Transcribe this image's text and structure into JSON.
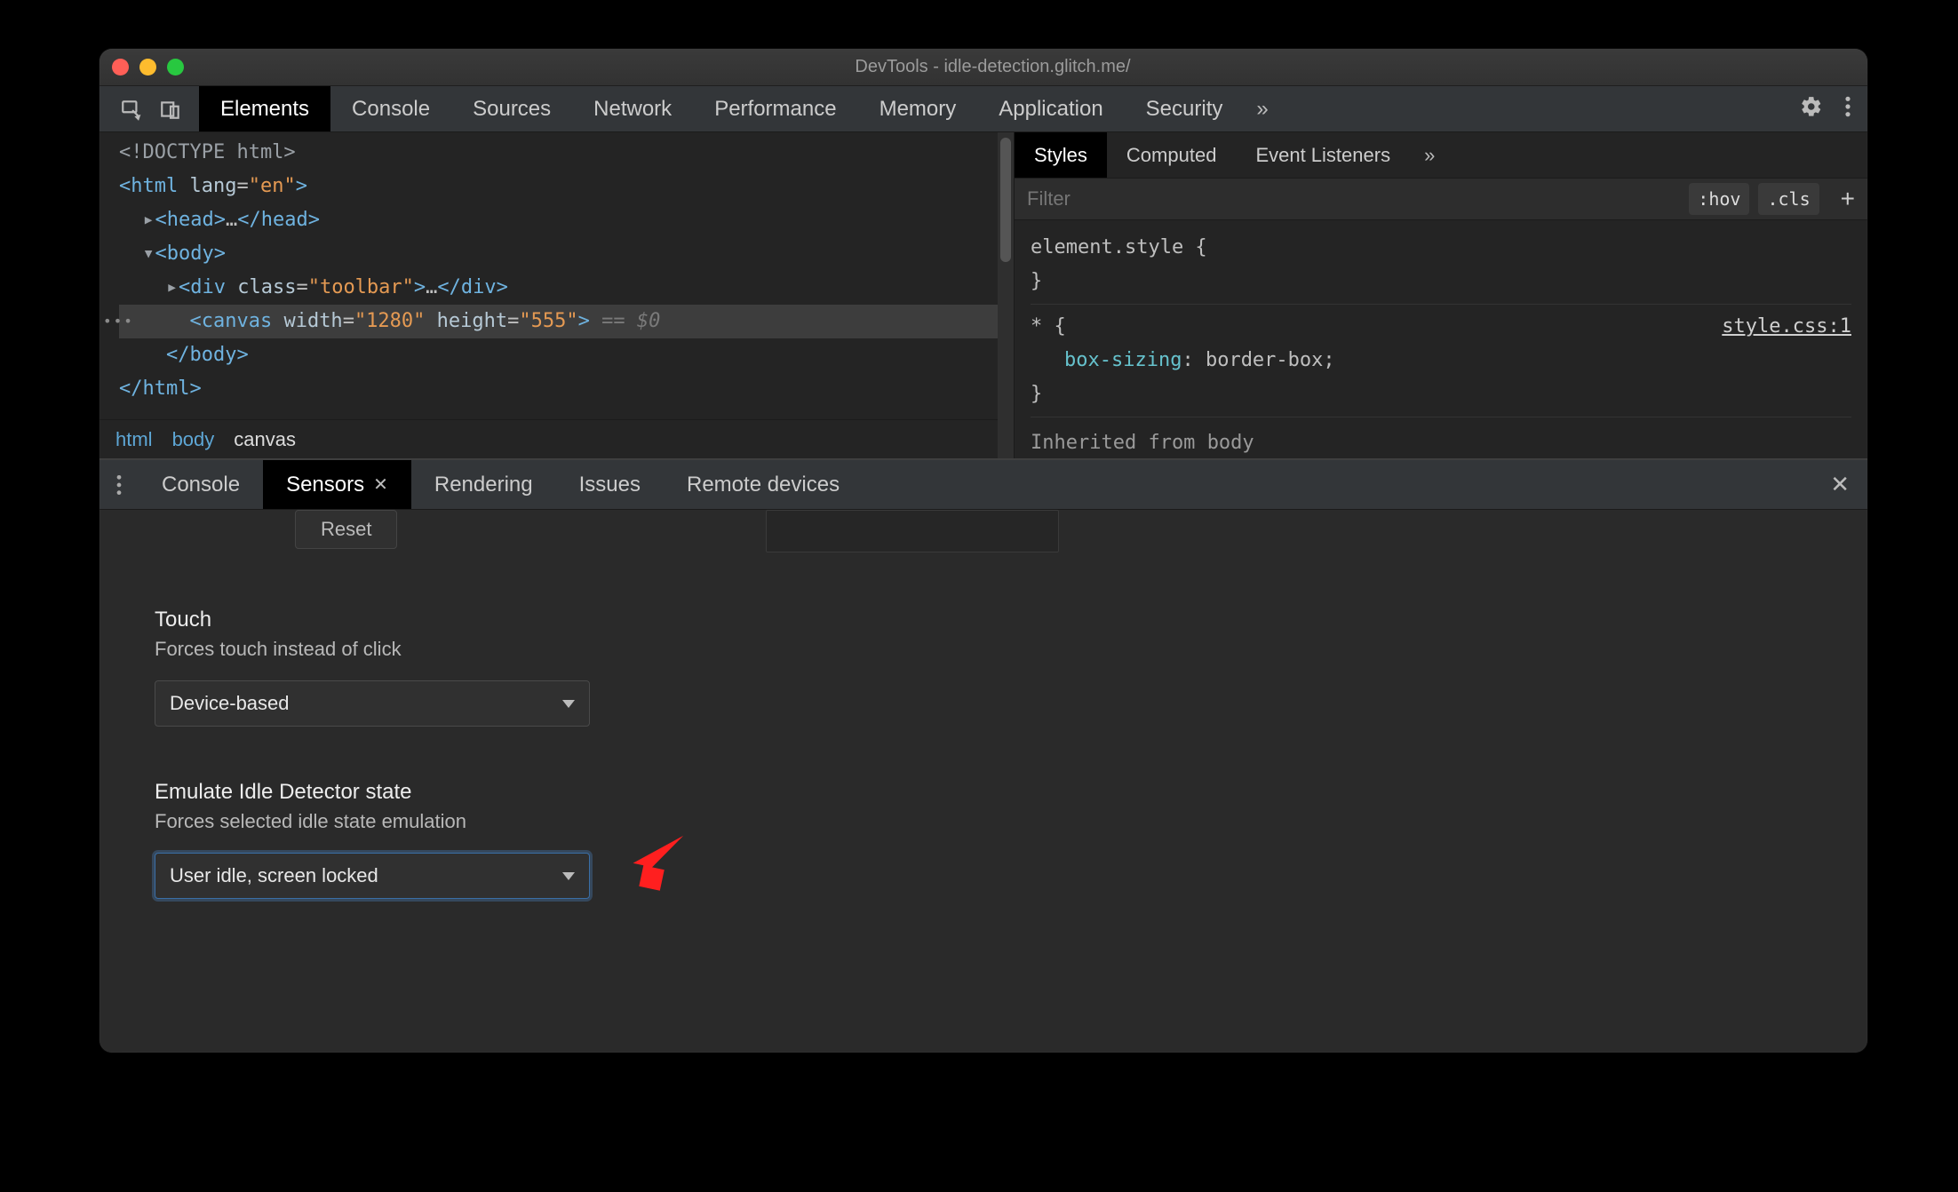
{
  "window": {
    "title": "DevTools - idle-detection.glitch.me/"
  },
  "mainTabs": {
    "items": [
      "Elements",
      "Console",
      "Sources",
      "Network",
      "Performance",
      "Memory",
      "Application",
      "Security"
    ],
    "activeIndex": 0,
    "more": "»"
  },
  "dom": {
    "lines": [
      {
        "raw": "<!DOCTYPE html>",
        "cls": "doctype"
      },
      {
        "raw": "<html lang=\"en\">",
        "cls": "open",
        "indent": 0
      },
      {
        "raw": "▸ <head>…</head>",
        "cls": "collapsed",
        "indent": 1
      },
      {
        "raw": "▾ <body>",
        "cls": "open",
        "indent": 1
      },
      {
        "raw": "▸ <div class=\"toolbar\">…</div>",
        "cls": "collapsed",
        "indent": 2
      },
      {
        "raw": "  <canvas width=\"1280\" height=\"555\"> == $0",
        "cls": "selected",
        "indent": 2
      },
      {
        "raw": "</body>",
        "cls": "close",
        "indent": 1
      },
      {
        "raw": "</html>",
        "cls": "close",
        "indent": 0
      }
    ]
  },
  "crumbs": [
    "html",
    "body",
    "canvas"
  ],
  "stylesPanel": {
    "tabs": [
      "Styles",
      "Computed",
      "Event Listeners"
    ],
    "activeIndex": 0,
    "more": "»",
    "filterPlaceholder": "Filter",
    "hov": ":hov",
    "cls": ".cls",
    "plus": "+",
    "rules": [
      {
        "selector": "element.style {",
        "props": [],
        "close": "}"
      },
      {
        "selector": "* {",
        "origin": "style.css:1",
        "props": [
          {
            "k": "box-sizing",
            "v": "border-box;"
          }
        ],
        "close": "}"
      }
    ],
    "inheritedLabel": "Inherited from",
    "inheritedFrom": "body"
  },
  "drawer": {
    "tabs": [
      "Console",
      "Sensors",
      "Rendering",
      "Issues",
      "Remote devices"
    ],
    "activeIndex": 1,
    "closable": [
      false,
      true,
      false,
      false,
      false
    ],
    "resetLabel": "Reset"
  },
  "sensors": {
    "touch": {
      "title": "Touch",
      "sub": "Forces touch instead of click",
      "value": "Device-based"
    },
    "idle": {
      "title": "Emulate Idle Detector state",
      "sub": "Forces selected idle state emulation",
      "value": "User idle, screen locked"
    }
  },
  "annotation": {
    "arrowColor": "#ff1f1f"
  }
}
